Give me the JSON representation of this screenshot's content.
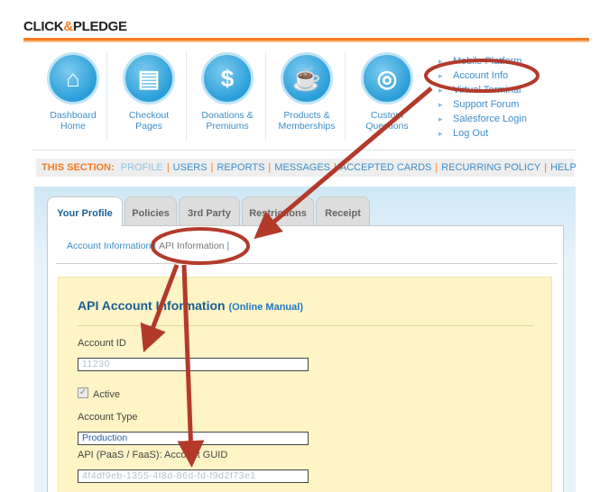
{
  "logo": {
    "part1": "CLICK",
    "amp": "&",
    "part2": "PLEDGE"
  },
  "icons": [
    {
      "label": "Dashboard\nHome",
      "glyph": "⌂",
      "icon": "house-icon"
    },
    {
      "label": "Checkout\nPages",
      "glyph": "▤",
      "icon": "page-icon"
    },
    {
      "label": "Donations &\nPremiums",
      "glyph": "$",
      "icon": "dollar-icon"
    },
    {
      "label": "Products &\nMemberships",
      "glyph": "☕",
      "icon": "mug-icon"
    },
    {
      "label": "Custom\nQuestions",
      "glyph": "◎",
      "icon": "question-icon"
    }
  ],
  "right_links": [
    "Mobile Platform",
    "Account Info",
    "Virtual Terminal",
    "Support Forum",
    "Salesforce Login",
    "Log Out"
  ],
  "section": {
    "label": "THIS SECTION:",
    "items": [
      "PROFILE",
      "USERS",
      "REPORTS",
      "MESSAGES",
      "ACCEPTED CARDS",
      "RECURRING POLICY",
      "HELP"
    ]
  },
  "tabs": [
    "Your Profile",
    "Policies",
    "3rd Party",
    "Restrictions",
    "Receipt"
  ],
  "subnav": {
    "first": "Account Information",
    "second": "API Information"
  },
  "api": {
    "title": "API Account Information",
    "manual": "(Online Manual)",
    "account_id_label": "Account ID",
    "account_id_value": "11230",
    "active_label": "Active",
    "account_type_label": "Account Type",
    "account_type_value": "Production",
    "guid_label": "API (PaaS / FaaS): Account GUID",
    "guid_value": "4f4df9eb-1355-4f8d-86d-fd-f9d2f73e1"
  },
  "colors": {
    "accent_orange": "#f47b20",
    "link_blue": "#3b8ec8",
    "annotation_red": "#b33a2a"
  }
}
